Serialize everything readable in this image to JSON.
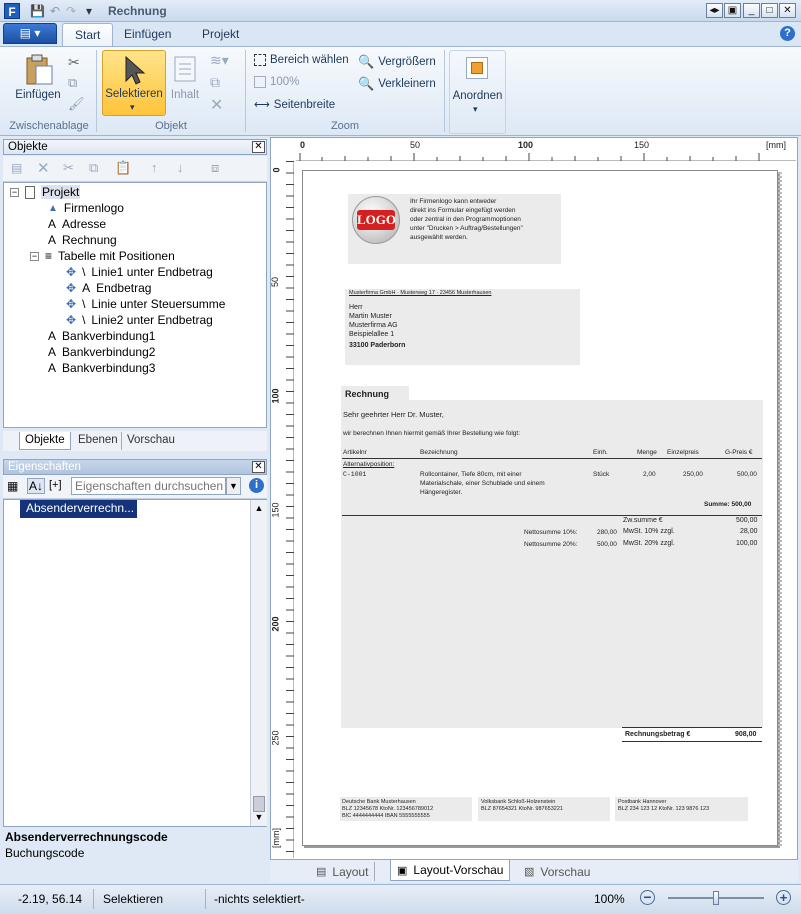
{
  "window": {
    "title": "Rechnung",
    "min": "_",
    "max": "□",
    "close": "✕",
    "restore1": "◂▸",
    "restore2": "▣"
  },
  "ribbon": {
    "tabs": [
      "Start",
      "Einfügen",
      "Projekt"
    ],
    "file_menu": "▤ ▾",
    "groups": {
      "clipboard": "Zwischenablage",
      "object": "Objekt",
      "zoom": "Zoom"
    },
    "buttons": {
      "paste": "Einfügen",
      "select": "Selektieren",
      "content": "Inhalt",
      "select_area": "Bereich wählen",
      "zoom_100": "100%",
      "page_width": "Seitenbreite",
      "zoom_in": "Vergrößern",
      "zoom_out": "Verkleinern",
      "arrange": "Anordnen"
    }
  },
  "objects_panel": {
    "title": "Objekte",
    "tree": [
      {
        "label": "Projekt",
        "icon": "page-icon"
      },
      {
        "label": "Firmenlogo",
        "icon": "image-icon"
      },
      {
        "label": "Adresse",
        "icon": "text-icon"
      },
      {
        "label": "Rechnung",
        "icon": "text-icon"
      },
      {
        "label": "Tabelle mit Positionen",
        "icon": "table-icon"
      },
      {
        "label": "Linie1 unter Endbetrag",
        "icon": "line-icon"
      },
      {
        "label": "Endbetrag",
        "icon": "text-icon"
      },
      {
        "label": "Linie unter Steuersumme",
        "icon": "line-icon"
      },
      {
        "label": "Linie2 unter Endbetrag",
        "icon": "line-icon"
      },
      {
        "label": "Bankverbindung1",
        "icon": "text-icon"
      },
      {
        "label": "Bankverbindung2",
        "icon": "text-icon"
      },
      {
        "label": "Bankverbindung3",
        "icon": "text-icon"
      }
    ],
    "tabs": [
      "Objekte",
      "Ebenen",
      "Vorschau"
    ]
  },
  "properties_panel": {
    "title": "Eigenschaften",
    "search_placeholder": "Eigenschaften durchsuchen",
    "plus_label": "[+]",
    "selected_item": "Absenderverrechn...",
    "description_title": "Absenderverrechnungscode",
    "description_text": "Buchungscode"
  },
  "ruler": {
    "unit": "[mm]",
    "h_ticks": [
      "0",
      "50",
      "100",
      "150"
    ],
    "v_ticks": [
      "0",
      "50",
      "100",
      "150",
      "200",
      "250"
    ],
    "v_unit": "[mm]"
  },
  "document": {
    "logo_text": "LOGO",
    "logo_note": [
      "Ihr Firmenlogo kann entweder",
      "direkt ins Formular eingefügt werden",
      "oder zentral in den Programmoptionen",
      "unter \"Drucken > Auftrag/Bestellungen\"",
      "ausgewählt werden."
    ],
    "sender_line": "Musterfirma GmbH · Musterweg 17 · 23456 Musterhausen",
    "address": [
      "Herr",
      "Martin Muster",
      "Musterfirma AG",
      "Beispielallee 1",
      "33100 Paderborn"
    ],
    "heading": "Rechnung",
    "salutation": "Sehr geehrter Herr Dr. Muster,",
    "intro": "wir berechnen Ihnen hiermit gemäß Ihrer Bestellung wie folgt:",
    "table_headers": [
      "Artikelnr",
      "Bezeichnung",
      "Einh.",
      "Menge",
      "Einzelpreis",
      "G-Preis €"
    ],
    "alt_position": "Alternativposition:",
    "row": {
      "artnr": "C-1001",
      "desc": [
        "Rollcontainer, Tiefe 80cm, mit einer",
        "Materialschale, einer Schublade und einem",
        "Hängeregister."
      ],
      "unit": "Stück",
      "qty": "2,00",
      "price": "250,00",
      "total": "500,00"
    },
    "sum_label": "Summe: 500,00",
    "subtotal_label": "Zw.summe €",
    "subtotal": "500,00",
    "net10_label": "Nettosumme 10%:",
    "net10": "280,00",
    "vat10_label": "MwSt. 10% zzgl.",
    "vat10": "28,00",
    "net20_label": "Nettosumme 20%:",
    "net20": "500,00",
    "vat20_label": "MwSt. 20% zzgl.",
    "vat20": "100,00",
    "total_label": "Rechnungsbetrag €",
    "total": "908,00",
    "banks": [
      [
        "Deutsche Bank Musterhausen",
        "BLZ 12345678   KtoNr. 123456789012",
        "BIC 4444444444 IBAN 5555555555"
      ],
      [
        "Volksbank Schloß-Holzenstein",
        "BLZ 87654321   KtoNr. 987653221"
      ],
      [
        "Postbank Hannover",
        "BLZ 234 123 12   KtoNr. 123 9876 123"
      ]
    ]
  },
  "view_tabs": [
    "Layout",
    "Layout-Vorschau",
    "Vorschau"
  ],
  "status": {
    "coords": "-2.19, 56.14",
    "mode": "Selektieren",
    "selection": "-nichts selektiert-",
    "zoom": "100%",
    "zoom_slider": 0.5
  }
}
